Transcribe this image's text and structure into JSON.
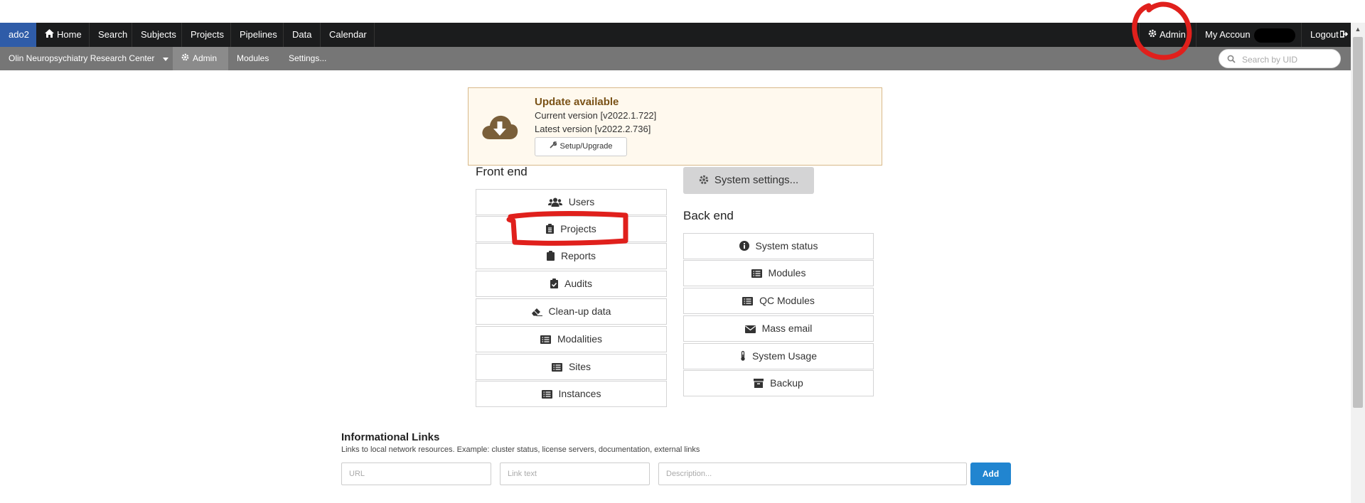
{
  "topnav": {
    "brand": "ado2",
    "items": [
      "Home",
      "Search",
      "Subjects",
      "Projects",
      "Pipelines",
      "Data",
      "Calendar"
    ],
    "right": {
      "admin": "Admin",
      "account": "My Accoun",
      "logout": "Logout"
    }
  },
  "subnav": {
    "site": "Olin Neuropsychiatry Research Center",
    "admin": "Admin",
    "modules": "Modules",
    "settings": "Settings...",
    "search_placeholder": "Search by UID"
  },
  "update": {
    "title": "Update available",
    "current": "Current version [v2022.1.722]",
    "latest": "Latest version [v2022.2.736]",
    "button": "Setup/Upgrade"
  },
  "frontend": {
    "heading": "Front end",
    "items": [
      "Users",
      "Projects",
      "Reports",
      "Audits",
      "Clean-up data",
      "Modalities",
      "Sites",
      "Instances"
    ]
  },
  "system_settings": "System settings...",
  "backend": {
    "heading": "Back end",
    "items": [
      "System status",
      "Modules",
      "QC Modules",
      "Mass email",
      "System Usage",
      "Backup"
    ]
  },
  "links": {
    "title": "Informational Links",
    "description": "Links to local network resources. Example: cluster status, license servers, documentation, external links",
    "url_placeholder": "URL",
    "text_placeholder": "Link text",
    "desc_placeholder": "Description...",
    "add": "Add"
  },
  "colors": {
    "brand": "#2f5ca8",
    "update_title": "#7a5217",
    "add_button": "#2185d0",
    "annotation": "#e0201c"
  }
}
